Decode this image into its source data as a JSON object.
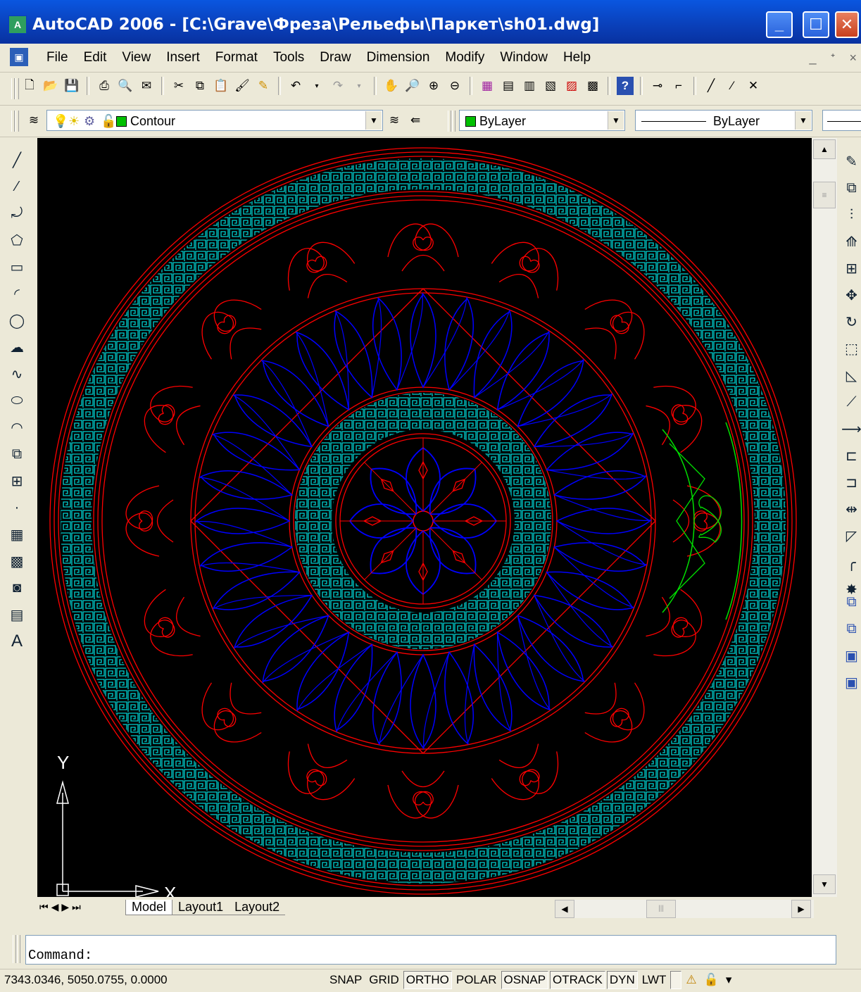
{
  "window": {
    "title": "AutoCAD 2006 - [C:\\Grave\\Фреза\\Рельефы\\Паркет\\sh01.dwg]",
    "app_icon": "autocad-app-icon",
    "buttons": {
      "minimize": "_",
      "maximize": "☐",
      "close": "✕"
    }
  },
  "menu": {
    "items": [
      {
        "label": "File"
      },
      {
        "label": "Edit"
      },
      {
        "label": "View"
      },
      {
        "label": "Insert"
      },
      {
        "label": "Format"
      },
      {
        "label": "Tools"
      },
      {
        "label": "Draw"
      },
      {
        "label": "Dimension"
      },
      {
        "label": "Modify"
      },
      {
        "label": "Window"
      },
      {
        "label": "Help"
      }
    ],
    "mdi": {
      "minimize": "_",
      "restore": "ᐩ",
      "close": "×"
    }
  },
  "layers": {
    "current_layer": "Contour",
    "color": "ByLayer",
    "linetype": "ByLayer",
    "layer_color_hex": "#00c000"
  },
  "tabs": [
    {
      "label": "Model",
      "active": true
    },
    {
      "label": "Layout1",
      "active": false
    },
    {
      "label": "Layout2",
      "active": false
    }
  ],
  "ucs": {
    "x_label": "X",
    "y_label": "Y"
  },
  "command": {
    "prompt": "Command:"
  },
  "status": {
    "coordinates": "7343.0346, 5050.0755, 0.0000",
    "buttons": [
      {
        "label": "SNAP",
        "on": false
      },
      {
        "label": "GRID",
        "on": false
      },
      {
        "label": "ORTHO",
        "on": true
      },
      {
        "label": "POLAR",
        "on": false
      },
      {
        "label": "OSNAP",
        "on": true
      },
      {
        "label": "OTRACK",
        "on": true
      },
      {
        "label": "DYN",
        "on": true
      },
      {
        "label": "LWT",
        "on": false
      }
    ]
  },
  "colors": {
    "red": "#ff0000",
    "blue": "#0000ff",
    "cyan": "#00d0d0",
    "green": "#00e000",
    "canvas": "#000000"
  }
}
